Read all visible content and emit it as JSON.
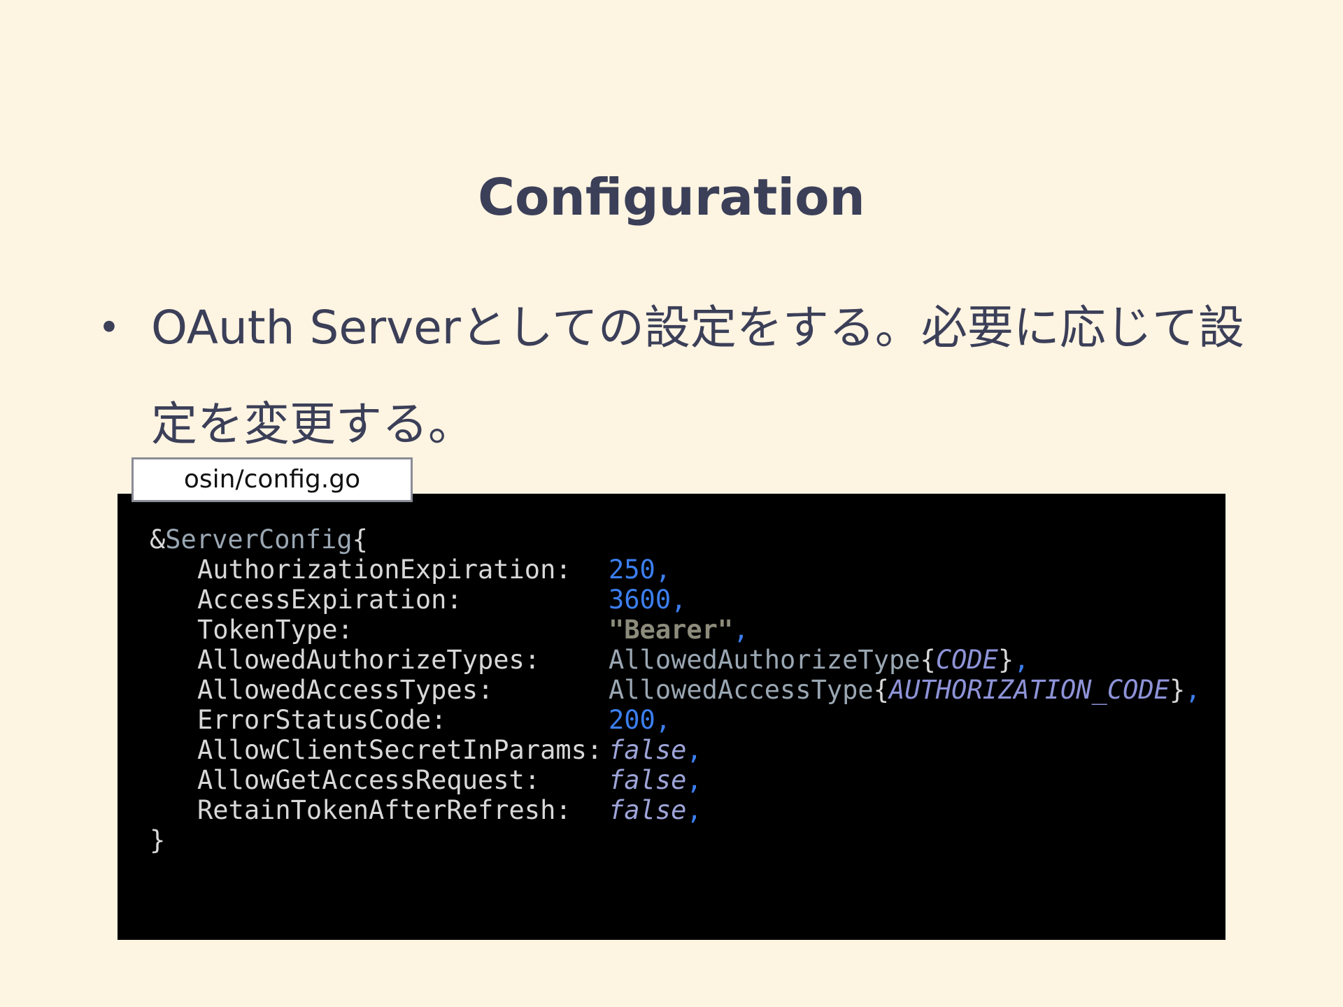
{
  "slide": {
    "title": "Configuration",
    "bullet_marker": "•",
    "bullet_text": "OAuth Serverとしての設定をする。必要に応じて設定を変更する。"
  },
  "file_tab": {
    "label": "osin/config.go"
  },
  "code": {
    "open_prefix": "&",
    "open_type": "ServerConfig",
    "open_brace": "{",
    "close_brace": "}",
    "lines": [
      {
        "key": "AuthorizationExpiration:",
        "value": "250",
        "suffix": ","
      },
      {
        "key": "AccessExpiration:",
        "value": "3600",
        "suffix": ","
      },
      {
        "key": "TokenType:",
        "value": "\"Bearer\"",
        "suffix": ","
      },
      {
        "key": "AllowedAuthorizeTypes:",
        "type": "AllowedAuthorizeType",
        "brace_open": "{",
        "enum": "CODE",
        "brace_close": "}",
        "suffix": ","
      },
      {
        "key": "AllowedAccessTypes:",
        "type": "AllowedAccessType",
        "brace_open": "{",
        "enum": "AUTHORIZATION_CODE",
        "brace_close": "}",
        "suffix": ","
      },
      {
        "key": "ErrorStatusCode:",
        "value": "200",
        "suffix": ","
      },
      {
        "key": "AllowClientSecretInParams:",
        "value": "false",
        "suffix": ","
      },
      {
        "key": "AllowGetAccessRequest:",
        "value": "false",
        "suffix": ","
      },
      {
        "key": "RetainTokenAfterRefresh:",
        "value": "false",
        "suffix": ","
      }
    ]
  },
  "colors": {
    "background": "#fef4e2",
    "text": "#3b3f58",
    "code_background": "#000000",
    "number": "#3c7ff0",
    "string": "#8d8c7c",
    "type": "#9aa7b3",
    "enum": "#8e93d8",
    "boolean": "#9ea5d9"
  }
}
